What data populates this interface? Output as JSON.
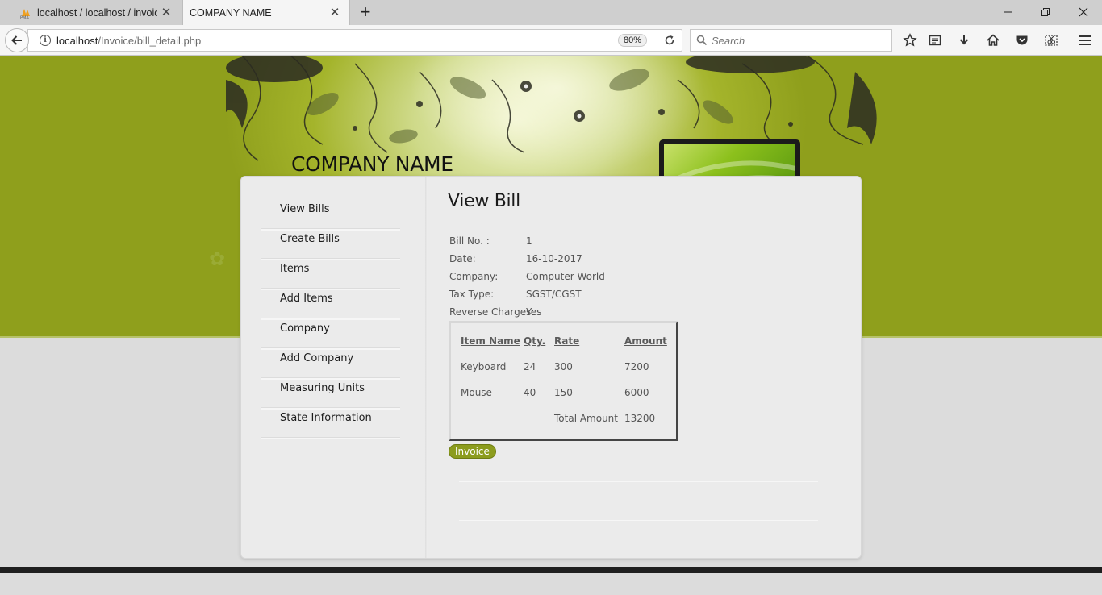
{
  "browser": {
    "tabs": [
      {
        "title": "localhost / localhost / invoice",
        "icon": "phpmyadmin-favicon",
        "active": false
      },
      {
        "title": "COMPANY NAME",
        "active": true
      }
    ],
    "url_host": "localhost",
    "url_path": "/Invoice/bill_detail.php",
    "zoom": "80%",
    "search_placeholder": "Search"
  },
  "site": {
    "title": "COMPANY NAME"
  },
  "menu": [
    {
      "label": "View Bills"
    },
    {
      "label": "Create Bills"
    },
    {
      "label": "Items"
    },
    {
      "label": "Add Items"
    },
    {
      "label": "Company"
    },
    {
      "label": "Add Company"
    },
    {
      "label": "Measuring Units"
    },
    {
      "label": "State Information"
    }
  ],
  "bill": {
    "heading": "View Bill",
    "fields": [
      {
        "label": "Bill No. :",
        "value": "1"
      },
      {
        "label": "Date:",
        "value": "16-10-2017"
      },
      {
        "label": "Company:",
        "value": "Computer World"
      },
      {
        "label": "Tax Type:",
        "value": "SGST/CGST"
      },
      {
        "label": "Reverse Charges:",
        "value": "Yes"
      }
    ],
    "table": {
      "headers": [
        "Item Name",
        "Qty.",
        "Rate",
        "Amount"
      ],
      "rows": [
        [
          "Keyboard",
          "24",
          "300",
          "7200"
        ],
        [
          "Mouse",
          "40",
          "150",
          "6000"
        ]
      ],
      "total_label": "Total Amount",
      "total_value": "13200"
    },
    "invoice_button": "Invoice"
  },
  "colors": {
    "accent": "#8c9c1e",
    "header_green": "#8f9f1c"
  }
}
